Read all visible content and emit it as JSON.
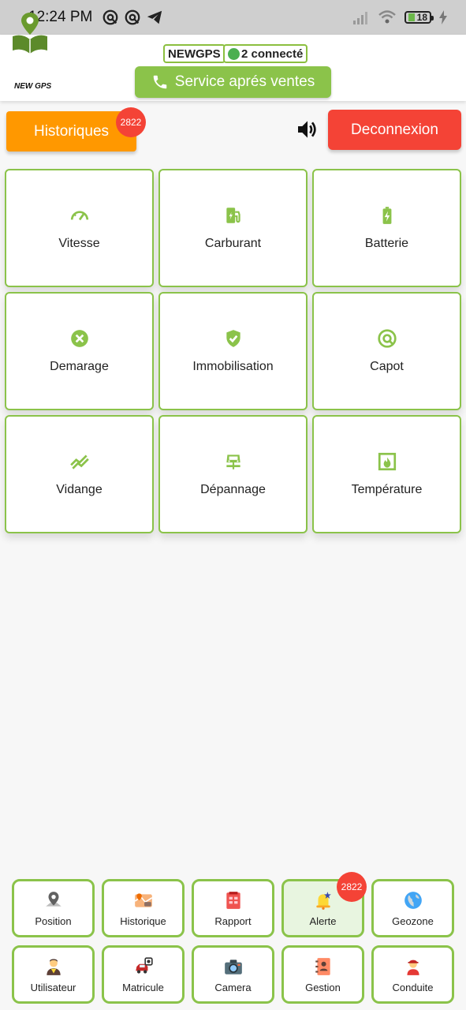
{
  "status_bar": {
    "time": "12:24 PM",
    "battery": "18"
  },
  "header": {
    "logo_text": "NEW GPS",
    "brand": "NEWGPS",
    "connected": "2 connecté",
    "service_button": "Service aprés ventes"
  },
  "actions": {
    "historiques": "Historiques",
    "historiques_badge": "2822",
    "deconnexion": "Deconnexion"
  },
  "alerts": [
    {
      "label": "Vitesse",
      "icon": "speedometer-icon"
    },
    {
      "label": "Carburant",
      "icon": "fuel-icon"
    },
    {
      "label": "Batterie",
      "icon": "battery-charging-icon"
    },
    {
      "label": "Demarage",
      "icon": "cancel-circle-icon"
    },
    {
      "label": "Immobilisation",
      "icon": "shield-check-icon"
    },
    {
      "label": "Capot",
      "icon": "target-icon"
    },
    {
      "label": "Vidange",
      "icon": "trend-lines-icon"
    },
    {
      "label": "Dépannage",
      "icon": "tow-truck-icon"
    },
    {
      "label": "Température",
      "icon": "fireplace-icon"
    }
  ],
  "bottom_nav": [
    {
      "label": "Position",
      "icon": "map-pin-icon"
    },
    {
      "label": "Historique",
      "icon": "map-history-icon"
    },
    {
      "label": "Rapport",
      "icon": "report-icon"
    },
    {
      "label": "Alerte",
      "icon": "alarm-bell-icon",
      "badge": "2822",
      "active": true
    },
    {
      "label": "Geozone",
      "icon": "globe-icon"
    },
    {
      "label": "Utilisateur",
      "icon": "user-icon"
    },
    {
      "label": "Matricule",
      "icon": "car-plate-icon"
    },
    {
      "label": "Camera",
      "icon": "camera-icon"
    },
    {
      "label": "Gestion",
      "icon": "contacts-book-icon"
    },
    {
      "label": "Conduite",
      "icon": "driver-icon"
    }
  ],
  "colors": {
    "accent": "#8bc34a",
    "orange": "#ff9800",
    "red": "#f44336"
  }
}
